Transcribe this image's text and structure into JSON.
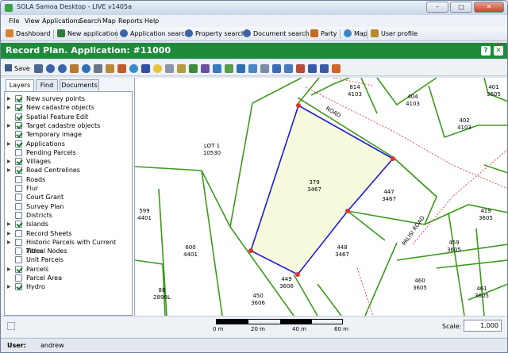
{
  "window": {
    "title": "SOLA Samoa Desktop - LIVE v1405a",
    "min": "–",
    "max": "□",
    "close": "✕"
  },
  "menu": [
    "File",
    "View",
    "Applications",
    "Search",
    "Map",
    "Reports",
    "Help"
  ],
  "toolbar": [
    {
      "label": "Dashboard",
      "icon": "home-icon",
      "color": "#d9822b"
    },
    {
      "label": "New application",
      "icon": "new-application-icon",
      "color": "#2f7d3a"
    },
    {
      "label": "Application search",
      "icon": "search-icon",
      "color": "#3b63a8"
    },
    {
      "label": "Property search",
      "icon": "search-icon",
      "color": "#3b63a8"
    },
    {
      "label": "Document search",
      "icon": "search-icon",
      "color": "#3b63a8"
    },
    {
      "label": "Party",
      "icon": "party-icon",
      "color": "#c46b1e"
    },
    {
      "label": "Map",
      "icon": "globe-icon",
      "color": "#3c84c8"
    },
    {
      "label": "User profile",
      "icon": "user-icon",
      "color": "#b58b2a"
    }
  ],
  "header": {
    "title": "Record Plan. Application: #11000",
    "help": "?",
    "close": "✕"
  },
  "toolbar2": {
    "save_label": "Save"
  },
  "tabs": [
    {
      "label": "Layers",
      "active": true
    },
    {
      "label": "Find",
      "active": false
    },
    {
      "label": "Documents",
      "active": false
    }
  ],
  "layers": [
    {
      "label": "New survey points",
      "checked": true,
      "expand": true
    },
    {
      "label": "New cadastre objects",
      "checked": true,
      "expand": true
    },
    {
      "label": "Spatial Feature Edit",
      "checked": true,
      "expand": false
    },
    {
      "label": "Target cadastre objects",
      "checked": true,
      "expand": true
    },
    {
      "label": "Temporary image",
      "checked": true,
      "expand": false
    },
    {
      "label": "Applications",
      "checked": true,
      "expand": true
    },
    {
      "label": "Pending Parcels",
      "checked": false,
      "expand": false
    },
    {
      "label": "Villages",
      "checked": true,
      "expand": true
    },
    {
      "label": "Road Centrelines",
      "checked": true,
      "expand": true
    },
    {
      "label": "Roads",
      "checked": false,
      "expand": false
    },
    {
      "label": "Flur",
      "checked": false,
      "expand": false
    },
    {
      "label": "Court Grant",
      "checked": false,
      "expand": false
    },
    {
      "label": "Survey Plan",
      "checked": false,
      "expand": false
    },
    {
      "label": "Districts",
      "checked": false,
      "expand": false
    },
    {
      "label": "Islands",
      "checked": true,
      "expand": true
    },
    {
      "label": "Record Sheets",
      "checked": false,
      "expand": true
    },
    {
      "label": "Historic Parcels with Current Titles",
      "checked": false,
      "expand": true
    },
    {
      "label": "Parcel Nodes",
      "checked": false,
      "expand": false
    },
    {
      "label": "Unit Parcels",
      "checked": false,
      "expand": false
    },
    {
      "label": "Parcels",
      "checked": true,
      "expand": true
    },
    {
      "label": "Parcel Area",
      "checked": false,
      "expand": false
    },
    {
      "label": "Hydro",
      "checked": true,
      "expand": true
    }
  ],
  "map": {
    "labels": [
      {
        "a": "814",
        "b": "4103"
      },
      {
        "a": "404",
        "b": "4103"
      },
      {
        "a": "401",
        "b": "3605"
      },
      {
        "a": "402",
        "b": "4103"
      },
      {
        "a": "LOT 1",
        "b": "10530"
      },
      {
        "a": "379",
        "b": "3467"
      },
      {
        "a": "447",
        "b": "3467"
      },
      {
        "a": "599",
        "b": "4401"
      },
      {
        "a": "419",
        "b": "3605"
      },
      {
        "a": "600",
        "b": "4401"
      },
      {
        "a": "448",
        "b": "3467"
      },
      {
        "a": "459",
        "b": "3605"
      },
      {
        "a": "449",
        "b": "3606"
      },
      {
        "a": "460",
        "b": "3605"
      },
      {
        "a": "461",
        "b": "3605"
      },
      {
        "a": "88",
        "b": "2890L"
      },
      {
        "a": "450",
        "b": "3606"
      }
    ],
    "roads": [
      "ROAD",
      "PALISI ROAD"
    ],
    "colors": {
      "parcel": "#3c9a1c",
      "selected": "#1a1ad6",
      "fill": "#f6f9dc",
      "road": "#e04040",
      "node": "#e03030"
    }
  },
  "scale": {
    "ticks": [
      "0 m",
      "20 m",
      "40 m",
      "60 m"
    ],
    "label": "Scale:",
    "value": "1,000"
  },
  "status": {
    "user_label": "User:",
    "user": "andrew"
  }
}
